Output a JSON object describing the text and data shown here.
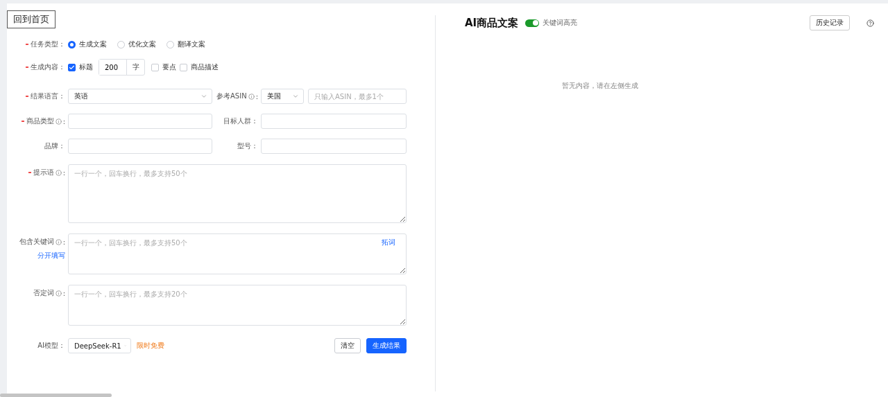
{
  "home_button": "回到首页",
  "task_type": {
    "label": "任务类型",
    "colon": "：",
    "required": true,
    "options": [
      {
        "label": "生成文案",
        "selected": true
      },
      {
        "label": "优化文案",
        "selected": false
      },
      {
        "label": "翻译文案",
        "selected": false
      }
    ]
  },
  "content": {
    "label": "生成内容",
    "colon": "：",
    "required": true,
    "items": [
      {
        "kind": "length",
        "label": "标题",
        "checked": true,
        "value": "200",
        "unit": "字"
      },
      {
        "kind": "plain",
        "label": "要点",
        "checked": false
      },
      {
        "kind": "plain",
        "label": "商品描述",
        "checked": false
      }
    ]
  },
  "grid_rows": [
    [
      {
        "label": "结果语言",
        "colon": "：",
        "required": true,
        "info": false,
        "kind": "select",
        "value": "英语"
      },
      {
        "label": "参考ASIN",
        "colon": ":",
        "required": false,
        "info": true,
        "kind": "select-input",
        "value": "美国",
        "placeholder": "只输入ASIN，最多1个"
      }
    ],
    [
      {
        "label": "商品类型",
        "colon": ":",
        "required": true,
        "info": true,
        "kind": "input"
      },
      {
        "label": "目标人群",
        "colon": "：",
        "required": false,
        "info": false,
        "kind": "input"
      }
    ],
    [
      {
        "label": "品牌",
        "colon": "：",
        "required": false,
        "info": false,
        "kind": "input"
      },
      {
        "label": "型号",
        "colon": "：",
        "required": false,
        "info": false,
        "kind": "input"
      }
    ]
  ],
  "textareas": [
    {
      "label": "提示语",
      "colon": ":",
      "required": true,
      "info": true,
      "kind": "tall",
      "placeholder": "一行一个，回车换行，最多支持50个"
    },
    {
      "label": "包含关键词",
      "colon": ":",
      "required": false,
      "info": true,
      "kind": "short",
      "placeholder": "一行一个，回车换行，最多支持50个",
      "link": "分开填写",
      "action": "拓词"
    },
    {
      "label": "否定词",
      "colon": ":",
      "required": false,
      "info": true,
      "kind": "short",
      "placeholder": "一行一个，回车换行，最多支持20个"
    }
  ],
  "model": {
    "label": "AI模型",
    "colon": "：",
    "value": "DeepSeek-R1",
    "note": "限时免费"
  },
  "buttons": [
    {
      "label": "清空",
      "kind": "default"
    },
    {
      "label": "生成结果",
      "kind": "primary"
    }
  ],
  "result": {
    "title": "AI商品文案",
    "toggle": {
      "label": "关键词高亮",
      "on": true
    },
    "history_button": "历史记录",
    "empty": "暂无内容，请在左侧生成"
  }
}
